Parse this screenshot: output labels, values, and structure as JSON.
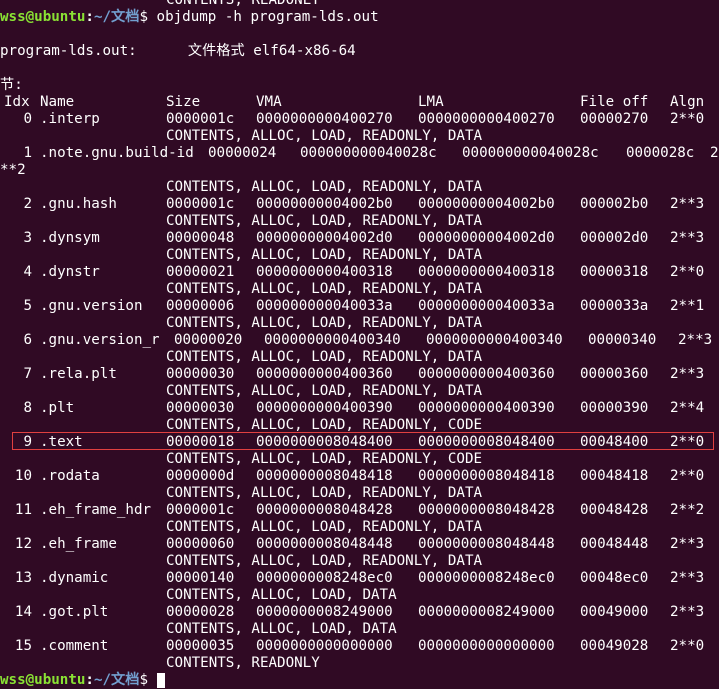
{
  "terminal": {
    "lines": {
      "l0": "CONTENTS, READONLY",
      "prompt_user": "wss@ubuntu",
      "prompt_sep": ":",
      "prompt_path": "~/文档",
      "prompt_dollar": "$",
      "command": " objdump -h program-lds.out",
      "fileformat": "program-lds.out:      文件格式 elf64-x86-64",
      "sections_label": "节:"
    },
    "headers": [
      "Idx",
      "Name",
      "Size",
      "VMA",
      "LMA",
      "File off",
      "Algn"
    ],
    "sections": [
      {
        "idx": "0",
        "name": ".interp",
        "size": "0000001c",
        "vma": "0000000000400270",
        "lma": "0000000000400270",
        "off": "00000270",
        "algn": "2**0",
        "flags": "CONTENTS, ALLOC, LOAD, READONLY, DATA"
      },
      {
        "idx": "1",
        "name": ".note.gnu.build-id",
        "size": "00000024",
        "vma": "000000000040028c",
        "lma": "000000000040028c",
        "off": "0000028c",
        "algn": "2",
        "algn_wrap": "**2",
        "flags": "CONTENTS, ALLOC, LOAD, READONLY, DATA"
      },
      {
        "idx": "2",
        "name": ".gnu.hash",
        "size": "0000001c",
        "vma": "00000000004002b0",
        "lma": "00000000004002b0",
        "off": "000002b0",
        "algn": "2**3",
        "flags": "CONTENTS, ALLOC, LOAD, READONLY, DATA"
      },
      {
        "idx": "3",
        "name": ".dynsym",
        "size": "00000048",
        "vma": "00000000004002d0",
        "lma": "00000000004002d0",
        "off": "000002d0",
        "algn": "2**3",
        "flags": "CONTENTS, ALLOC, LOAD, READONLY, DATA"
      },
      {
        "idx": "4",
        "name": ".dynstr",
        "size": "00000021",
        "vma": "0000000000400318",
        "lma": "0000000000400318",
        "off": "00000318",
        "algn": "2**0",
        "flags": "CONTENTS, ALLOC, LOAD, READONLY, DATA"
      },
      {
        "idx": "5",
        "name": ".gnu.version",
        "size": "00000006",
        "vma": "000000000040033a",
        "lma": "000000000040033a",
        "off": "0000033a",
        "algn": "2**1",
        "flags": "CONTENTS, ALLOC, LOAD, READONLY, DATA"
      },
      {
        "idx": "6",
        "name": ".gnu.version_r",
        "size": "00000020",
        "vma": "0000000000400340",
        "lma": "0000000000400340",
        "off": "00000340",
        "algn": "2**3",
        "flags": "CONTENTS, ALLOC, LOAD, READONLY, DATA"
      },
      {
        "idx": "7",
        "name": ".rela.plt",
        "size": "00000030",
        "vma": "0000000000400360",
        "lma": "0000000000400360",
        "off": "00000360",
        "algn": "2**3",
        "flags": "CONTENTS, ALLOC, LOAD, READONLY, DATA"
      },
      {
        "idx": "8",
        "name": ".plt",
        "size": "00000030",
        "vma": "0000000000400390",
        "lma": "0000000000400390",
        "off": "00000390",
        "algn": "2**4",
        "flags": "CONTENTS, ALLOC, LOAD, READONLY, CODE"
      },
      {
        "idx": "9",
        "name": ".text",
        "size": "00000018",
        "vma": "0000000008048400",
        "lma": "0000000008048400",
        "off": "00048400",
        "algn": "2**0",
        "flags": "CONTENTS, ALLOC, LOAD, READONLY, CODE"
      },
      {
        "idx": "10",
        "name": ".rodata",
        "size": "0000000d",
        "vma": "0000000008048418",
        "lma": "0000000008048418",
        "off": "00048418",
        "algn": "2**0",
        "flags": "CONTENTS, ALLOC, LOAD, READONLY, DATA"
      },
      {
        "idx": "11",
        "name": ".eh_frame_hdr",
        "size": "0000001c",
        "vma": "0000000008048428",
        "lma": "0000000008048428",
        "off": "00048428",
        "algn": "2**2",
        "flags": "CONTENTS, ALLOC, LOAD, READONLY, DATA"
      },
      {
        "idx": "12",
        "name": ".eh_frame",
        "size": "00000060",
        "vma": "0000000008048448",
        "lma": "0000000008048448",
        "off": "00048448",
        "algn": "2**3",
        "flags": "CONTENTS, ALLOC, LOAD, READONLY, DATA"
      },
      {
        "idx": "13",
        "name": ".dynamic",
        "size": "00000140",
        "vma": "0000000008248ec0",
        "lma": "0000000008248ec0",
        "off": "00048ec0",
        "algn": "2**3",
        "flags": "CONTENTS, ALLOC, LOAD, DATA"
      },
      {
        "idx": "14",
        "name": ".got.plt",
        "size": "00000028",
        "vma": "0000000008249000",
        "lma": "0000000008249000",
        "off": "00049000",
        "algn": "2**3",
        "flags": "CONTENTS, ALLOC, LOAD, DATA"
      },
      {
        "idx": "15",
        "name": ".comment",
        "size": "00000035",
        "vma": "0000000000000000",
        "lma": "0000000000000000",
        "off": "00049028",
        "algn": "2**0",
        "flags": "CONTENTS, READONLY"
      }
    ],
    "colors": {
      "background": "#300a24",
      "text": "#ffffff",
      "prompt_user": "#8ae234",
      "prompt_path": "#729fcf",
      "highlight_border": "#e04040"
    }
  }
}
